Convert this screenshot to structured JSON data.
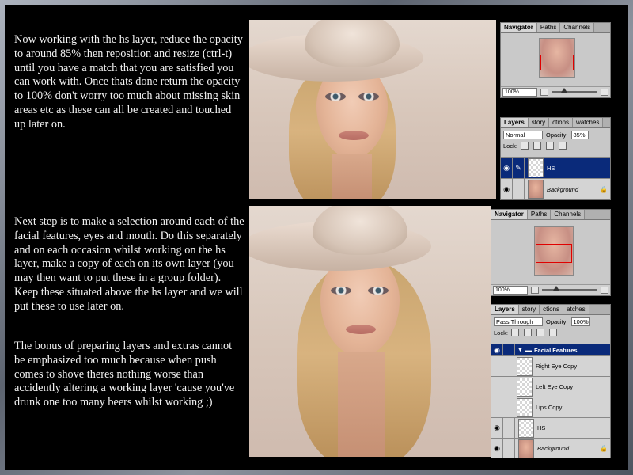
{
  "paragraphs": {
    "p1": "Now working with the hs layer, reduce the opacity to around 85% then reposition and resize (ctrl-t) until you have a match that you are satisfied you can work with.  Once thats done return the opacity to 100%  don't worry too much about missing skin areas etc as these can all be created and touched up later on.",
    "p2": "Next step is to make a selection around each of the facial features, eyes and mouth. Do this separately and on each occasion whilst working on the hs layer, make a copy of each on its own layer (you may then want to put these in a group folder). Keep these situated above the hs layer and we will put these to use later on.",
    "p3": "The bonus of preparing layers and extras cannot be emphasized too much because when push comes to shove theres nothing worse than accidently altering a working layer 'cause you've drunk one too many beers whilst working ;)"
  },
  "shot1": {
    "navigator": {
      "tabs": [
        "Navigator",
        "Paths",
        "Channels"
      ],
      "zoom": "100%"
    },
    "layers": {
      "tabs": [
        "Layers",
        "story",
        "ctions",
        "watches"
      ],
      "blend_mode": "Normal",
      "opacity_label": "Opacity:",
      "opacity_value": "85%",
      "lock_label": "Lock:",
      "layers": [
        {
          "name": "HS",
          "selected": true
        },
        {
          "name": "Background",
          "selected": false
        }
      ]
    }
  },
  "shot2": {
    "navigator": {
      "tabs": [
        "Navigator",
        "Paths",
        "Channels"
      ],
      "zoom": "100%"
    },
    "layers": {
      "tabs": [
        "Layers",
        "story",
        "ctions",
        "atches"
      ],
      "blend_mode": "Pass Through",
      "opacity_label": "Opacity:",
      "opacity_value": "100%",
      "lock_label": "Lock:",
      "folder": "Facial Features",
      "group_layers": [
        "Right Eye Copy",
        "Left Eye Copy",
        "Lips Copy"
      ],
      "layers": [
        "HS",
        "Background"
      ]
    }
  },
  "colors": {
    "selected_layer": "#0a2a7a",
    "navigator_box": "#e00000"
  }
}
